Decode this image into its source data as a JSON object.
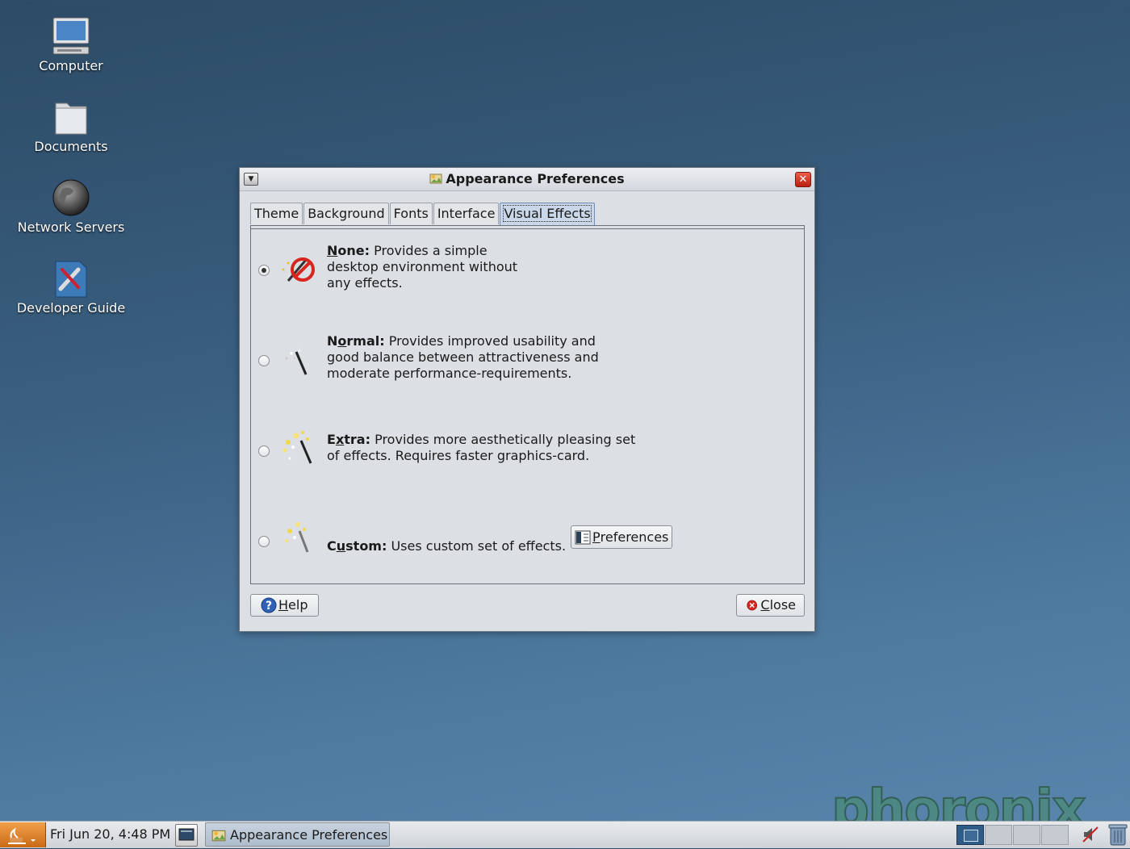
{
  "desktop": {
    "icons": [
      {
        "label": "Computer",
        "icon": "computer-icon"
      },
      {
        "label": "Documents",
        "icon": "folder-icon"
      },
      {
        "label": "Network Servers",
        "icon": "network-globe-icon"
      },
      {
        "label": "Developer Guide",
        "icon": "developer-tools-icon"
      }
    ],
    "watermark": "phoronix"
  },
  "dialog": {
    "title": "Appearance Preferences",
    "tabs": [
      {
        "label": "Theme"
      },
      {
        "label": "Background"
      },
      {
        "label": "Fonts"
      },
      {
        "label": "Interface"
      },
      {
        "label": "Visual Effects"
      }
    ],
    "active_tab": "Visual Effects",
    "options": [
      {
        "name": "None",
        "key": "N",
        "rest": "one:",
        "line1": " Provides a simple",
        "line2": "desktop environment without",
        "line3": "any effects.",
        "selected": true
      },
      {
        "name": "Normal",
        "key": "o",
        "pre": "N",
        "rest": "rmal:",
        "line1": " Provides improved usability and",
        "line2": "good balance between attractiveness and",
        "line3": "moderate performance-requirements.",
        "selected": false
      },
      {
        "name": "Extra",
        "key": "x",
        "pre": "E",
        "rest": "tra:",
        "line1": " Provides more aesthetically pleasing set",
        "line2": "of effects. Requires faster graphics-card.",
        "selected": false
      },
      {
        "name": "Custom",
        "key": "u",
        "pre": "C",
        "rest": "stom:",
        "line1": " Uses custom set of effects.",
        "selected": false
      }
    ],
    "preferences_button": {
      "key": "P",
      "rest": "references"
    },
    "help_button": {
      "key": "H",
      "rest": "elp"
    },
    "close_button": {
      "key": "C",
      "rest": "lose"
    }
  },
  "taskbar": {
    "clock": "Fri Jun 20,  4:48 PM",
    "task_label": "Appearance Preferences",
    "workspaces": 4,
    "active_workspace": 1
  },
  "colors": {
    "desktop_top": "#2c4b66",
    "desktop_bottom": "#5a86ad",
    "active_tab": "#c9d7e8",
    "close_button_red": "#d8341f",
    "start_orange": "#e08a30"
  }
}
